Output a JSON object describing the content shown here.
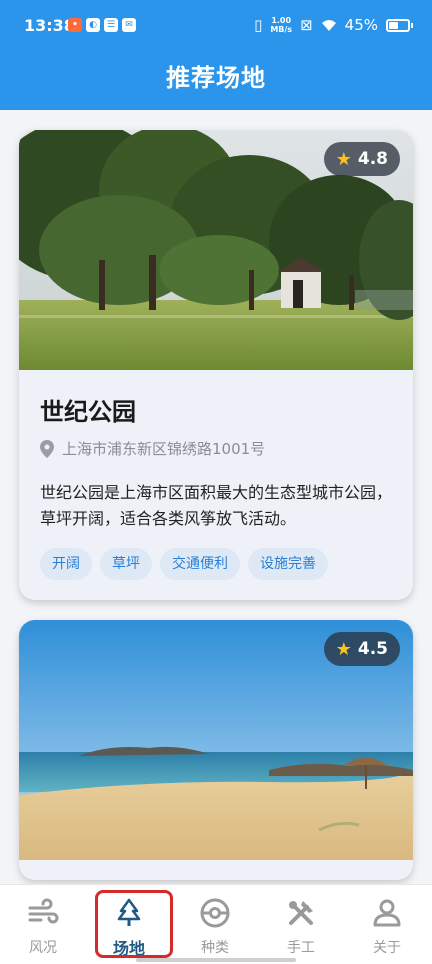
{
  "status_bar": {
    "time": "13:38",
    "speed_value": "1.00",
    "speed_unit": "MB/s",
    "battery": "45%"
  },
  "header": {
    "title": "推荐场地"
  },
  "venues": [
    {
      "name": "世纪公园",
      "rating": "4.8",
      "address": "上海市浦东新区锦绣路1001号",
      "description": "世纪公园是上海市区面积最大的生态型城市公园，草坪开阔，适合各类风筝放飞活动。",
      "tags": [
        "开阔",
        "草坪",
        "交通便利",
        "设施完善"
      ]
    },
    {
      "rating": "4.5"
    }
  ],
  "bottom_nav": {
    "items": [
      {
        "label": "风况",
        "icon": "wind-icon"
      },
      {
        "label": "场地",
        "icon": "tree-icon",
        "active": true
      },
      {
        "label": "种类",
        "icon": "pokeball-icon"
      },
      {
        "label": "手工",
        "icon": "tools-icon"
      },
      {
        "label": "关于",
        "icon": "person-icon"
      }
    ]
  },
  "colors": {
    "primary": "#2b95ec",
    "active_nav": "#1f5a85",
    "tag_text": "#2a7fd4",
    "tag_bg": "#dfe9f6",
    "star": "#ffc21a",
    "highlight": "#d42a2a"
  }
}
